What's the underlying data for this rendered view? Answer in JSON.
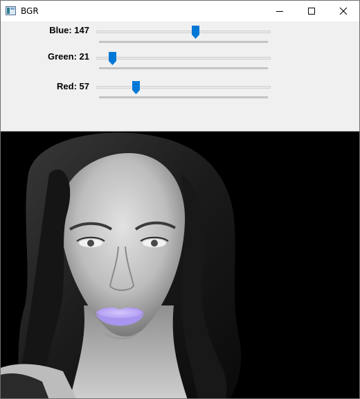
{
  "window": {
    "title": "BGR",
    "buttons": {
      "minimize": "minimize-icon",
      "maximize": "maximize-icon",
      "close": "close-icon"
    }
  },
  "trackbars": [
    {
      "label": "Blue: 147",
      "value": 147,
      "max": 255
    },
    {
      "label": "Green: 21",
      "value": 21,
      "max": 255
    },
    {
      "label": "Red: 57",
      "value": 57,
      "max": 255
    }
  ],
  "colors": {
    "thumb": "#0078d7",
    "lips": "#b7a3f5",
    "panel": "#f0f0f0"
  }
}
